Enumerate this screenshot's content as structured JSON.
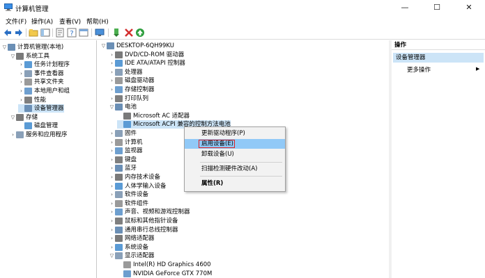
{
  "window": {
    "title": "计算机管理",
    "controls": {
      "minimize": "—",
      "maximize": "☐",
      "close": "✕"
    }
  },
  "menu": [
    "文件(F)",
    "操作(A)",
    "查看(V)",
    "帮助(H)"
  ],
  "toolbar": {
    "icons": [
      "back-arrow-icon",
      "forward-arrow-icon",
      "folder-up-icon",
      "show-tree-icon",
      "properties-icon",
      "help-icon",
      "console-icon",
      "monitor-icon",
      "update-driver-icon",
      "uninstall-icon",
      "enable-icon"
    ]
  },
  "left_tree": [
    {
      "label": "计算机管理(本地)",
      "level": 0,
      "expander": "▽"
    },
    {
      "label": "系统工具",
      "level": 1,
      "expander": "▽"
    },
    {
      "label": "任务计划程序",
      "level": 2,
      "expander": "›"
    },
    {
      "label": "事件查看器",
      "level": 2,
      "expander": "›"
    },
    {
      "label": "共享文件夹",
      "level": 2,
      "expander": "›"
    },
    {
      "label": "本地用户和组",
      "level": 2,
      "expander": "›"
    },
    {
      "label": "性能",
      "level": 2,
      "expander": "›"
    },
    {
      "label": "设备管理器",
      "level": 2,
      "expander": "",
      "selected": true
    },
    {
      "label": "存储",
      "level": 1,
      "expander": "▽"
    },
    {
      "label": "磁盘管理",
      "level": 2,
      "expander": ""
    },
    {
      "label": "服务和应用程序",
      "level": 1,
      "expander": "›"
    }
  ],
  "device_tree": [
    {
      "label": "DESKTOP-6QH99KU",
      "level": 0,
      "expander": "▽"
    },
    {
      "label": "DVD/CD-ROM 驱动器",
      "level": 1,
      "expander": "›"
    },
    {
      "label": "IDE ATA/ATAPI 控制器",
      "level": 1,
      "expander": "›"
    },
    {
      "label": "处理器",
      "level": 1,
      "expander": "›"
    },
    {
      "label": "磁盘驱动器",
      "level": 1,
      "expander": "›"
    },
    {
      "label": "存储控制器",
      "level": 1,
      "expander": "›"
    },
    {
      "label": "打印队列",
      "level": 1,
      "expander": "›"
    },
    {
      "label": "电池",
      "level": 1,
      "expander": "▽"
    },
    {
      "label": "Microsoft AC 适配器",
      "level": 2,
      "expander": ""
    },
    {
      "label": "Microsoft ACPI 兼容的控制方法电池",
      "level": 2,
      "expander": "",
      "selected": true
    },
    {
      "label": "固件",
      "level": 1,
      "expander": "›"
    },
    {
      "label": "计算机",
      "level": 1,
      "expander": "›"
    },
    {
      "label": "监视器",
      "level": 1,
      "expander": "›"
    },
    {
      "label": "键盘",
      "level": 1,
      "expander": "›"
    },
    {
      "label": "蓝牙",
      "level": 1,
      "expander": "›"
    },
    {
      "label": "内存技术设备",
      "level": 1,
      "expander": "›"
    },
    {
      "label": "人体学输入设备",
      "level": 1,
      "expander": "›"
    },
    {
      "label": "软件设备",
      "level": 1,
      "expander": "›"
    },
    {
      "label": "软件组件",
      "level": 1,
      "expander": "›"
    },
    {
      "label": "声音、视频和游戏控制器",
      "level": 1,
      "expander": "›"
    },
    {
      "label": "鼠标和其他指针设备",
      "level": 1,
      "expander": "›"
    },
    {
      "label": "通用串行总线控制器",
      "level": 1,
      "expander": "›"
    },
    {
      "label": "网络适配器",
      "level": 1,
      "expander": "›"
    },
    {
      "label": "系统设备",
      "level": 1,
      "expander": "›"
    },
    {
      "label": "显示适配器",
      "level": 1,
      "expander": "▽"
    },
    {
      "label": "Intel(R) HD Graphics 4600",
      "level": 2,
      "expander": ""
    },
    {
      "label": "NVIDIA GeForce GTX 770M",
      "level": 2,
      "expander": ""
    }
  ],
  "context_menu": {
    "items": [
      "更新驱动程序(P)",
      "启用设备(E)",
      "卸载设备(U)",
      "扫描检测硬件改动(A)",
      "属性(R)"
    ],
    "highlighted_index": 1
  },
  "actions_pane": {
    "header": "操作",
    "selected": "设备管理器",
    "more": "更多操作",
    "more_arrow": "▶"
  },
  "colors": {
    "selection": "#cce4f7",
    "context_highlight": "#91c9f7",
    "highlight_box": "#e02020"
  }
}
